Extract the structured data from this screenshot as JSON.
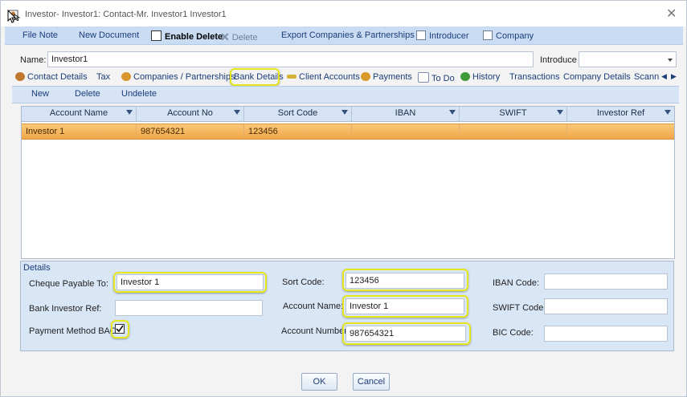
{
  "window": {
    "title": "Investor- Investor1: Contact-Mr. Investor1 Investor1"
  },
  "toolbar": {
    "file_note": "File Note",
    "new_document": "New Document",
    "enable_delete": "Enable Delete",
    "delete": "Delete",
    "export": "Export Companies & Partnerships",
    "introducer": "Introducer",
    "company": "Company"
  },
  "header": {
    "name_label": "Name:",
    "name_value": "Investor1",
    "introducer_label": "Introduce"
  },
  "tabs": [
    {
      "label": "Contact Details",
      "icon": "contact-icon",
      "color": "#c0782f"
    },
    {
      "label": "Tax"
    },
    {
      "label": "Companies / Partnerships",
      "icon": "people-icon",
      "color": "#d9962f"
    },
    {
      "label": "Bank Details",
      "active": true
    },
    {
      "label": "Client Accounts",
      "icon": "pencil-icon",
      "color": "#d4b23a"
    },
    {
      "label": "Payments",
      "icon": "coins-icon",
      "color": "#d89a2a"
    },
    {
      "label": "To Do",
      "icon": "calendar-icon",
      "color": "#7a8fb0"
    },
    {
      "label": "History",
      "icon": "globe-icon",
      "color": "#3f9a3a"
    },
    {
      "label": "Transactions"
    },
    {
      "label": "Company Details"
    },
    {
      "label": "Scann"
    }
  ],
  "subtoolbar": {
    "new": "New",
    "delete": "Delete",
    "undelete": "Undelete"
  },
  "grid": {
    "columns": [
      "Account Name",
      "Account No",
      "Sort Code",
      "IBAN",
      "SWIFT",
      "Investor Ref"
    ],
    "rows": [
      [
        "Investor 1",
        "987654321",
        "123456",
        "",
        "",
        ""
      ]
    ]
  },
  "details": {
    "group_title": "Details",
    "cheque_payable_label": "Cheque Payable To:",
    "cheque_payable_value": "Investor 1",
    "bank_investor_ref_label": "Bank Investor Ref:",
    "bank_investor_ref_value": "",
    "payment_method_label": "Payment Method BACS:",
    "payment_method_checked": true,
    "sort_code_label": "Sort Code:",
    "sort_code_value": "123456",
    "account_name_label": "Account Name:",
    "account_name_value": "Investor 1",
    "account_number_label": "Account Number:",
    "account_number_value": "987654321",
    "iban_label": "IBAN Code:",
    "swift_label": "SWIFT Code:",
    "bic_label": "BIC Code:"
  },
  "footer": {
    "ok": "OK",
    "cancel": "Cancel"
  },
  "colors": {
    "highlight": "#e6e61a",
    "selected_row": "#f1a64a",
    "toolbar_bg": "#c9dcf3"
  }
}
